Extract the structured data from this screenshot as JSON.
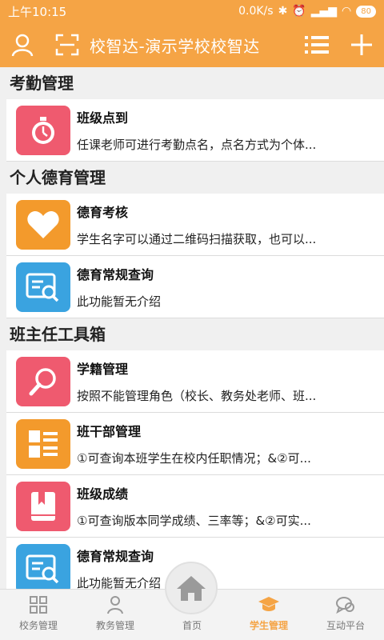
{
  "status": {
    "time": "上午10:15",
    "speed": "0.0K/s",
    "battery": "80"
  },
  "header": {
    "title": "校智达-演示学校校智达"
  },
  "sections": [
    {
      "title": "考勤管理",
      "items": [
        {
          "name": "班级点到",
          "desc": "任课老师可进行考勤点名，点名方式为个体...",
          "color": "#ef5a6f",
          "icon": "stopwatch-icon"
        }
      ]
    },
    {
      "title": "个人德育管理",
      "items": [
        {
          "name": "德育考核",
          "desc": "学生名字可以通过二维码扫描获取，也可以...",
          "color": "#f39a2c",
          "icon": "heart-icon"
        },
        {
          "name": "德育常规查询",
          "desc": "此功能暂无介绍",
          "color": "#3aa3e0",
          "icon": "search-card-icon"
        }
      ]
    },
    {
      "title": "班主任工具箱",
      "items": [
        {
          "name": "学籍管理",
          "desc": "按照不能管理角色（校长、教务处老师、班...",
          "color": "#ef5a6f",
          "icon": "magnifier-icon"
        },
        {
          "name": "班干部管理",
          "desc": "①可查询本班学生在校内任职情况；&②可...",
          "color": "#f39a2c",
          "icon": "list-grid-icon"
        },
        {
          "name": "班级成绩",
          "desc": "①可查询版本同学成绩、三率等；&②可实...",
          "color": "#ef5a6f",
          "icon": "bookmark-book-icon"
        },
        {
          "name": "德育常规查询",
          "desc": "此功能暂无介绍",
          "color": "#3aa3e0",
          "icon": "search-card-icon"
        }
      ]
    }
  ],
  "nav": [
    {
      "label": "校务管理",
      "icon": "grid-icon"
    },
    {
      "label": "教务管理",
      "icon": "person-icon"
    },
    {
      "label": "首页",
      "icon": "home-icon"
    },
    {
      "label": "学生管理",
      "icon": "graduation-cap-icon",
      "active": true
    },
    {
      "label": "互动平台",
      "icon": "chat-icon"
    }
  ],
  "colors": {
    "accent": "#f5a445",
    "red": "#ef5a6f",
    "orange": "#f39a2c",
    "blue": "#3aa3e0"
  }
}
